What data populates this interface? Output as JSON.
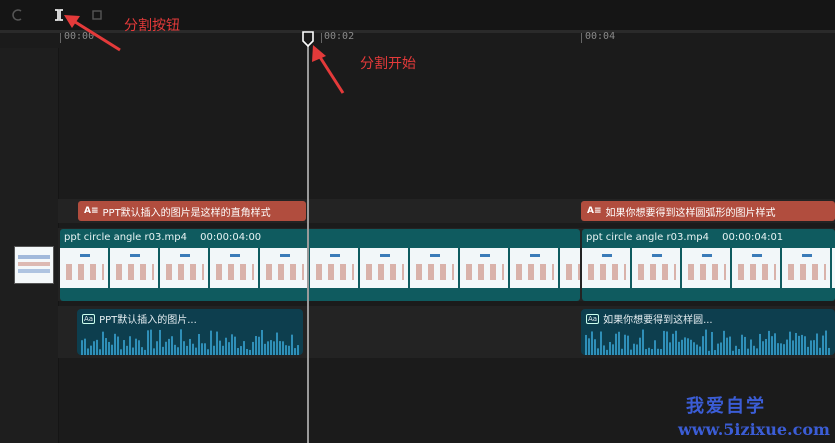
{
  "toolbar": {
    "undo_icon": "undo-icon",
    "split_icon": "split-icon",
    "crop_icon": "crop-icon"
  },
  "ruler": {
    "labels": [
      "00:00",
      "00:02",
      "00:04"
    ]
  },
  "tracks": {
    "title_clips": [
      {
        "icon": "A≡",
        "text": "PPT默认插入的图片是这样的直角样式"
      },
      {
        "icon": "A≡",
        "text": "如果你想要得到这样圆弧形的图片样式"
      }
    ],
    "video_clips": [
      {
        "name": "ppt circle angle r03.mp4",
        "duration": "00:00:04:00"
      },
      {
        "name": "ppt circle angle r03.mp4",
        "duration": "00:00:04:01"
      }
    ],
    "audio_clips": [
      {
        "icon": "Aa",
        "text": "PPT默认插入的图片..."
      },
      {
        "icon": "Aa",
        "text": "如果你想要得到这样圆..."
      }
    ]
  },
  "annotations": {
    "split_button": "分割按钮",
    "split_start": "分割开始"
  },
  "watermark": {
    "cn": "我爱自学",
    "url": "www.5izixue.com"
  },
  "colors": {
    "title_clip": "#b14d3e",
    "video_clip": "#0f5b5f",
    "audio_clip": "#0d3e4e",
    "waveform": "#2f8fb8",
    "annotation": "#e43a3a",
    "watermark": "#3b5dd6"
  }
}
